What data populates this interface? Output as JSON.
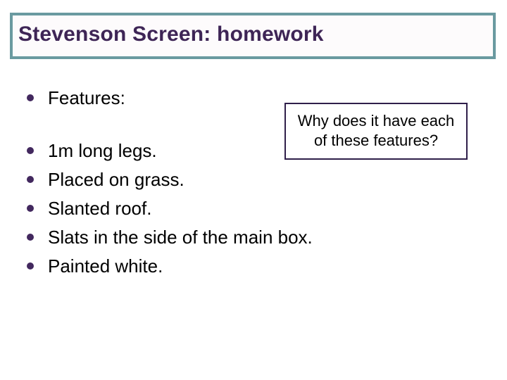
{
  "title": "Stevenson Screen: homework",
  "heading": "Features:",
  "items": [
    "1m long legs.",
    "Placed on grass.",
    "Slanted roof.",
    "Slats in the side of the main box.",
    "Painted white."
  ],
  "callout": "Why does it have each of these features?"
}
